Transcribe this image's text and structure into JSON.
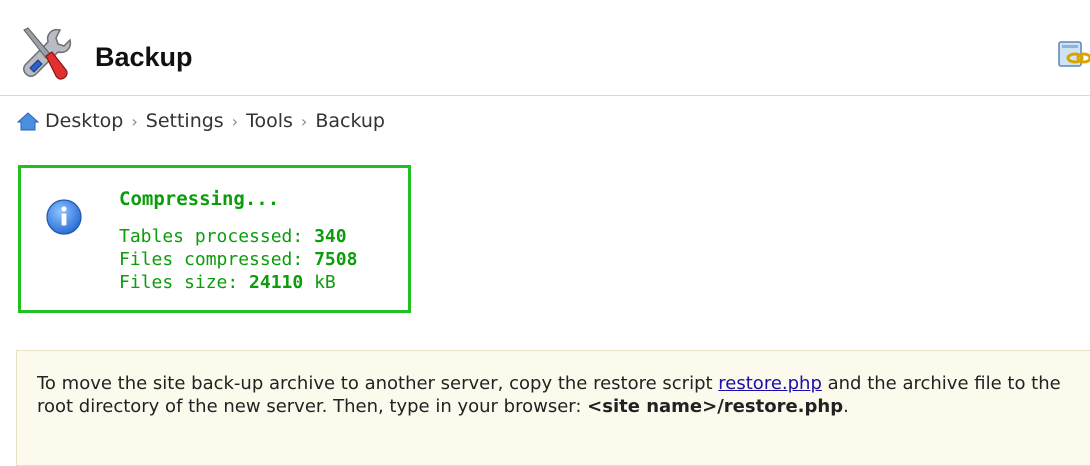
{
  "header": {
    "title": "Backup",
    "icon": "tools-icon",
    "action_icon": "link-icon"
  },
  "breadcrumb": {
    "items": [
      "Desktop",
      "Settings",
      "Tools",
      "Backup"
    ],
    "separator": "›",
    "home_icon": "home-icon"
  },
  "status": {
    "title": "Compressing...",
    "tables_label": "Tables processed: ",
    "tables_value": "340",
    "files_label": "Files compressed: ",
    "files_value": "7508",
    "size_label": "Files size: ",
    "size_value": "24110",
    "size_unit": " kB",
    "icon": "info-icon",
    "color": "#0c9c0c",
    "border_color": "#22c022"
  },
  "info": {
    "text_before_link": "To move the site back-up archive to another server, copy the restore script ",
    "link_text": "restore.php",
    "text_after_link": " and the archive file to the root directory of the new server. Then, type in your browser: ",
    "site_name": "<site name>",
    "path": "/restore.php",
    "ending": "."
  }
}
